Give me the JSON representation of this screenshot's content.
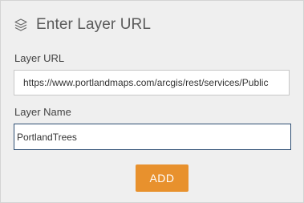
{
  "header": {
    "icon": "layers-icon",
    "title": "Enter Layer URL"
  },
  "layer_url": {
    "label": "Layer URL",
    "value": "https://www.portlandmaps.com/arcgis/rest/services/Public"
  },
  "layer_name": {
    "label": "Layer Name",
    "value": "PortlandTrees"
  },
  "actions": {
    "add_label": "ADD"
  },
  "colors": {
    "panel_background": "#efefef",
    "accent_button": "#e8912d",
    "focused_border": "#2f4f74",
    "title_text": "#5a5a5a"
  }
}
